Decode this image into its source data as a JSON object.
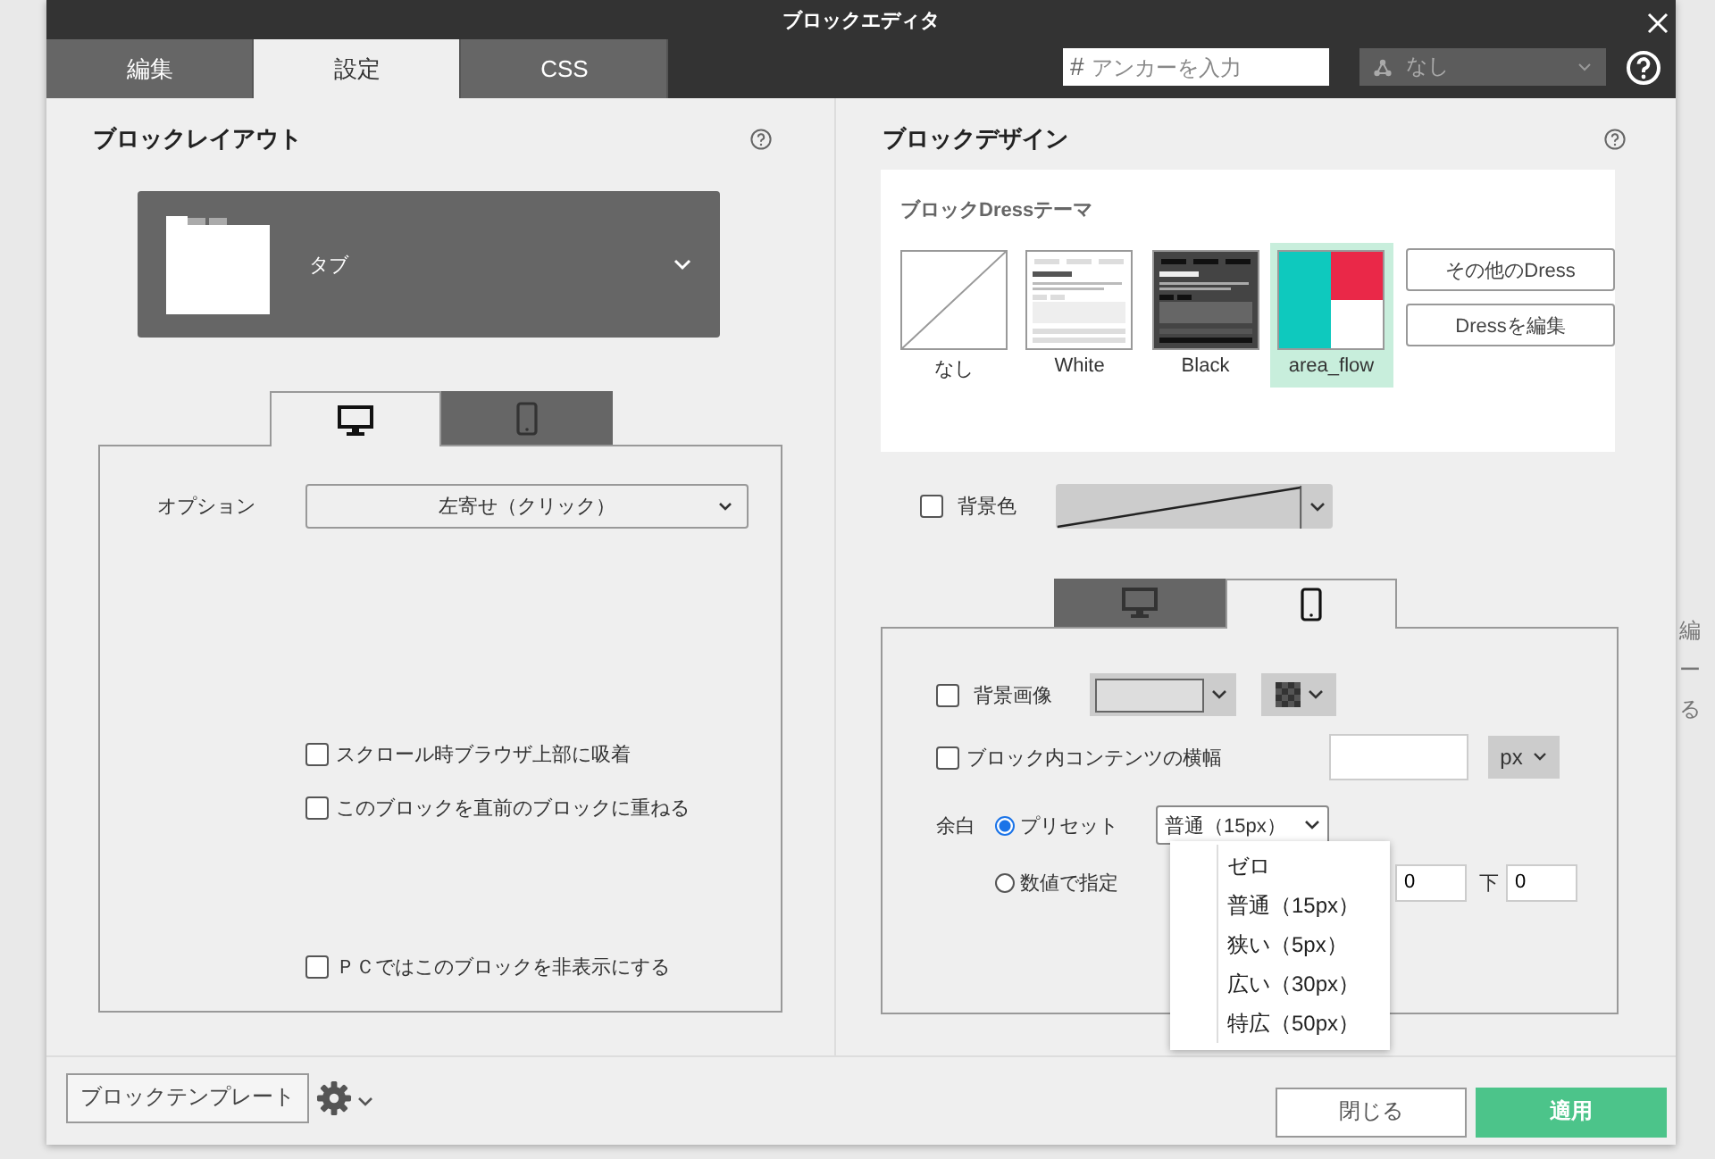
{
  "window": {
    "title": "ブロックエディタ"
  },
  "tabs": [
    {
      "label": "編集",
      "selected": false
    },
    {
      "label": "設定",
      "selected": true
    },
    {
      "label": "CSS",
      "selected": false
    }
  ],
  "anchor_field": {
    "prefix": "#",
    "placeholder": "アンカーを入力"
  },
  "anchor_select": {
    "value": "なし"
  },
  "layout": {
    "heading": "ブロックレイアウト",
    "selector": {
      "value": "タブ"
    },
    "device_tabs": [
      {
        "kind": "desktop",
        "selected": true
      },
      {
        "kind": "mobile",
        "selected": false
      }
    ],
    "option": {
      "label": "オプション",
      "value": "左寄せ（クリック）"
    },
    "checkboxes": [
      {
        "label": "スクロール時ブラウザ上部に吸着",
        "checked": false
      },
      {
        "label": "このブロックを直前のブロックに重ねる",
        "checked": false
      },
      {
        "label": "ＰＣではこのブロックを非表示にする",
        "checked": false
      }
    ]
  },
  "design": {
    "heading": "ブロックデザイン",
    "dress": {
      "label": "ブロックDressテーマ",
      "themes": [
        {
          "name": "なし",
          "kind": "none",
          "selected": false
        },
        {
          "name": "White",
          "kind": "white",
          "selected": false
        },
        {
          "name": "Black",
          "kind": "black",
          "selected": false
        },
        {
          "name": "area_flow",
          "kind": "colors",
          "selected": true
        }
      ],
      "buttons": [
        "その他のDress",
        "Dressを編集"
      ]
    },
    "background_color": {
      "label": "背景色",
      "checked": false
    },
    "device_tabs": [
      {
        "kind": "desktop",
        "selected": false
      },
      {
        "kind": "mobile",
        "selected": true
      }
    ],
    "background_image": {
      "label": "背景画像",
      "checked": false
    },
    "content_width": {
      "label": "ブロック内コンテンツの横幅",
      "checked": false,
      "unit": "px"
    },
    "margin": {
      "label": "余白",
      "options": [
        {
          "label": "プリセット",
          "selected": true
        },
        {
          "label": "数値で指定",
          "selected": false
        }
      ],
      "preset": "普通（15px）",
      "fields": [
        {
          "value": "0"
        },
        {
          "label": "下",
          "value": "0"
        }
      ],
      "menu": [
        "ゼロ",
        "普通（15px）",
        "狭い（5px）",
        "広い（30px）",
        "特広（50px）"
      ]
    }
  },
  "footer": {
    "template_button": "ブロックテンプレート",
    "buttons": [
      {
        "label": "閉じる",
        "kind": "secondary"
      },
      {
        "label": "適用",
        "kind": "primary"
      }
    ]
  },
  "background_page": {
    "texts": [
      "編",
      "ー",
      "る"
    ]
  }
}
